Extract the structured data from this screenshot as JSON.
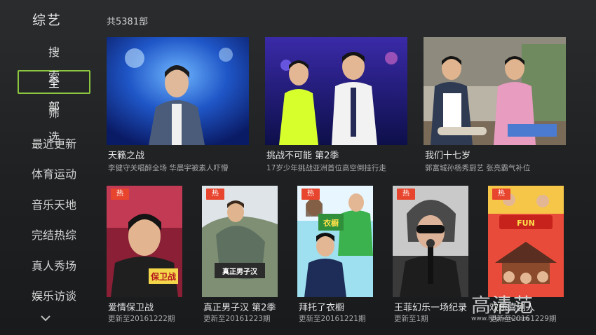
{
  "category": "综艺",
  "total": "共5381部",
  "nav": [
    {
      "label": "搜索",
      "name": "nav-search"
    },
    {
      "label": "全部",
      "name": "nav-all"
    },
    {
      "label": "筛选",
      "name": "nav-filter"
    },
    {
      "label": "最近更新",
      "name": "nav-recent"
    },
    {
      "label": "体育运动",
      "name": "nav-sports"
    },
    {
      "label": "音乐天地",
      "name": "nav-music"
    },
    {
      "label": "完结热综",
      "name": "nav-finished"
    },
    {
      "label": "真人秀场",
      "name": "nav-reality"
    },
    {
      "label": "娱乐访谈",
      "name": "nav-talk"
    }
  ],
  "active_nav": "全部",
  "row1": [
    {
      "title": "天籁之战",
      "subtitle": "李健守关唱醉全场 华晨宇被素人吓懵"
    },
    {
      "title": "挑战不可能 第2季",
      "subtitle": "17岁少年挑战亚洲首位高空倒挂行走"
    },
    {
      "title": "我们十七岁",
      "subtitle": "郭富城孙杨秀厨艺 张亮霸气补位"
    }
  ],
  "row2": [
    {
      "title": "爱情保卫战",
      "subtitle": "更新至20161222期",
      "badge": "热"
    },
    {
      "title": "真正男子汉 第2季",
      "subtitle": "更新至20161223期",
      "badge": "热"
    },
    {
      "title": "拜托了衣橱",
      "subtitle": "更新至20161221期",
      "badge": "热"
    },
    {
      "title": "王菲幻乐一场纪录",
      "subtitle": "更新至1期",
      "badge": "热"
    },
    {
      "title": "欢乐喜剧人",
      "subtitle": "更新至20161229期",
      "badge": "热"
    }
  ],
  "poster_texts": {
    "poster_a": "保卫战",
    "poster_b": "真正男子汉",
    "poster_c": "衣橱",
    "poster_d": "FUN"
  },
  "watermark": {
    "big": "高清范",
    "small": "www.hdpfans.com"
  },
  "colors": {
    "accent": "#8cc63f",
    "badge": "#e8452e"
  }
}
